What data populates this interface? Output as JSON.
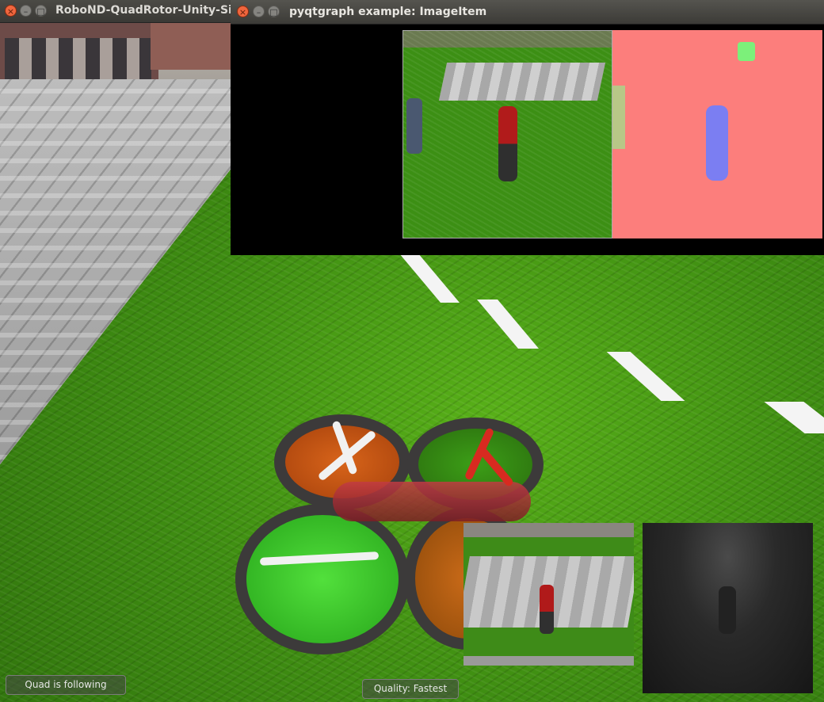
{
  "simulator": {
    "window_title": "RoboND-QuadRotor-Unity-Simu",
    "status_label": "Quad is following",
    "quality_label": "Quality: Fastest"
  },
  "viewer": {
    "window_title": "pyqtgraph example: ImageItem"
  },
  "icons": {
    "close": "×",
    "minimize": "–",
    "maximize": "□"
  },
  "colors": {
    "segmentation_background": "#fc7e7c",
    "segmentation_target": "#7b7ef2",
    "segmentation_others": "#7cf07a",
    "grass": "#3f8e12",
    "titlebar": "#3c3b37"
  }
}
